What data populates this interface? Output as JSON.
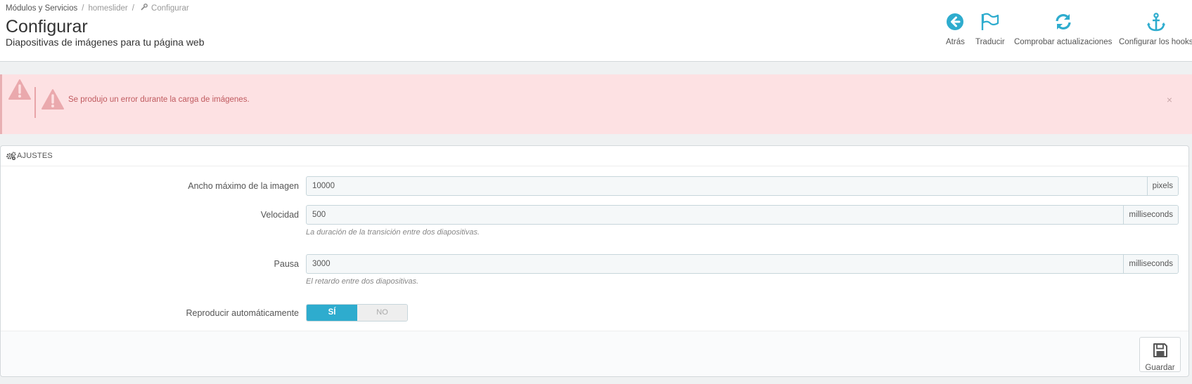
{
  "breadcrumb": {
    "items": [
      "Módulos y Servicios",
      "homeslider",
      "Configurar"
    ],
    "separator": "/"
  },
  "page": {
    "title": "Configurar",
    "subtitle": "Diapositivas de imágenes para tu página web"
  },
  "toolbar": {
    "back_label": "Atrás",
    "translate_label": "Traducir",
    "check_updates_label": "Comprobar actualizaciones",
    "hooks_label": "Configurar los hooks"
  },
  "alert": {
    "message": "Se produjo un error durante la carga de imágenes.",
    "close_symbol": "×"
  },
  "settings": {
    "heading": "AJUSTES",
    "max_width": {
      "label": "Ancho máximo de la imagen",
      "value": "10000",
      "unit": "pixels"
    },
    "speed": {
      "label": "Velocidad",
      "value": "500",
      "unit": "milliseconds",
      "help": "La duración de la transición entre dos diapositivas."
    },
    "pause": {
      "label": "Pausa",
      "value": "3000",
      "unit": "milliseconds",
      "help": "El retardo entre dos diapositivas."
    },
    "autoplay": {
      "label": "Reproducir automáticamente",
      "on_label": "SÍ",
      "off_label": "NO",
      "selected": "SÍ"
    }
  },
  "footer": {
    "save_label": "Guardar"
  },
  "colors": {
    "accent": "#2eacce",
    "alert_bg": "#fde1e3",
    "alert_text": "#c05a5f"
  },
  "icons": {
    "back": "arrow-circle-left-icon",
    "translate": "flag-icon",
    "check_updates": "refresh-icon",
    "hooks": "anchor-icon",
    "alert": "warning-icon",
    "settings": "cogs-icon",
    "save": "floppy-disk-icon",
    "breadcrumb": "wrench-icon"
  }
}
